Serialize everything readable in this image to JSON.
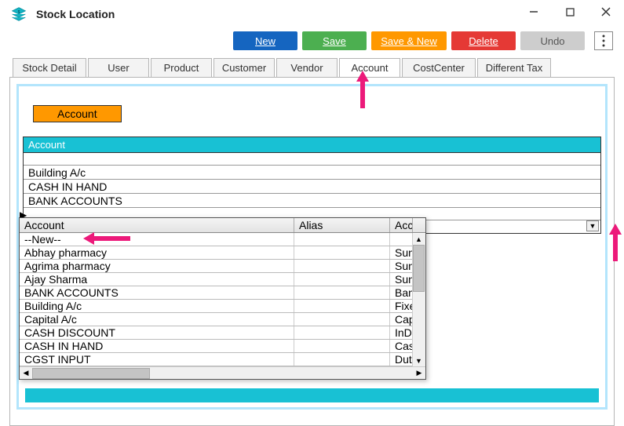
{
  "window": {
    "title": "Stock Location"
  },
  "toolbar": {
    "new": "New",
    "save": "Save",
    "save_new": "Save & New",
    "delete": "Delete",
    "undo": "Undo"
  },
  "tabs": {
    "items": [
      {
        "label": "Stock Detail"
      },
      {
        "label": "User"
      },
      {
        "label": "Product"
      },
      {
        "label": "Customer"
      },
      {
        "label": "Vendor"
      },
      {
        "label": "Account"
      },
      {
        "label": "CostCenter"
      },
      {
        "label": "Different Tax"
      }
    ],
    "active": "Account"
  },
  "account_tab": {
    "button_label": "Account",
    "grid": {
      "header": "Account",
      "rows": [
        "Building A/c",
        "CASH IN HAND",
        "BANK ACCOUNTS"
      ]
    }
  },
  "dropdown": {
    "columns": {
      "account": "Account",
      "alias": "Alias",
      "acctype": "Acc"
    },
    "rows": [
      {
        "account": "--New--",
        "alias": "",
        "type": ""
      },
      {
        "account": "Abhay pharmacy",
        "alias": "",
        "type": "Sun"
      },
      {
        "account": "Agrima pharmacy",
        "alias": "",
        "type": "Sun"
      },
      {
        "account": "Ajay Sharma",
        "alias": "",
        "type": "Sun"
      },
      {
        "account": "BANK ACCOUNTS",
        "alias": "",
        "type": "Ban"
      },
      {
        "account": "Building A/c",
        "alias": "",
        "type": "Fixe"
      },
      {
        "account": "Capital A/c",
        "alias": "",
        "type": "Cap"
      },
      {
        "account": "CASH DISCOUNT",
        "alias": "",
        "type": "InD"
      },
      {
        "account": "CASH IN HAND",
        "alias": "",
        "type": "Cas"
      },
      {
        "account": "CGST INPUT",
        "alias": "",
        "type": "Dut"
      }
    ]
  }
}
